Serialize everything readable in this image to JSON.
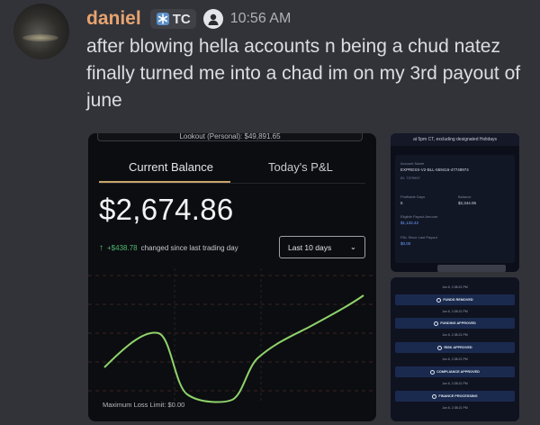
{
  "message": {
    "username": "daniel",
    "tag": {
      "icon": "snowflake-icon",
      "text": "TC"
    },
    "badge_icon": "avatar-badge-icon",
    "timestamp": "10:56 AM",
    "text": "after blowing hella accounts n being a chud natez finally turned me into a chad im on my 3rd payout of june",
    "accent_color": "#e6a470"
  },
  "left_screenshot": {
    "top_strip": "Lookout (Personal): $49,891.65",
    "tabs": [
      "Current Balance",
      "Today's P&L"
    ],
    "balance": "$2,674.86",
    "change_amount": "+$438.78",
    "change_label": "changed since last trading day",
    "period_select": "Last 10 days",
    "max_loss": "Maximum Loss Limit: $0.00",
    "line_color": "#8fd36b"
  },
  "right_top_screenshot": {
    "note": "at 5pm CT, excluding designated Holidays",
    "account_name_label": "Account Name",
    "account_name": "EXPRESS-V2-BLL-559416-47748974",
    "account_id": "ID: 7379997",
    "profitable_days_label": "Profitable Days",
    "profitable_days": "5",
    "balance_label": "Balance",
    "balance": "$2,344.06",
    "eligible_label": "Eligible Payout Amount",
    "eligible": "$1,132.42",
    "pnl_label": "P&L Since Last Payout",
    "pnl": "$0.00"
  },
  "right_bottom_screenshot": {
    "steps": [
      {
        "date": "Jun 6, 2:38:21 PM",
        "label": "FUNDS REMOVED"
      },
      {
        "date": "Jun 6, 2:38:21 PM",
        "label": "FUNDING APPROVED"
      },
      {
        "date": "Jun 6, 2:38:21 PM",
        "label": "RISK APPROVED"
      },
      {
        "date": "Jun 6, 2:38:21 PM",
        "label": "COMPLIANCE APPROVED"
      },
      {
        "date": "Jun 6, 2:38:21 PM",
        "label": "FINANCE PROCESSING"
      }
    ],
    "last_date": "Jun 6, 2:38:21 PM"
  }
}
